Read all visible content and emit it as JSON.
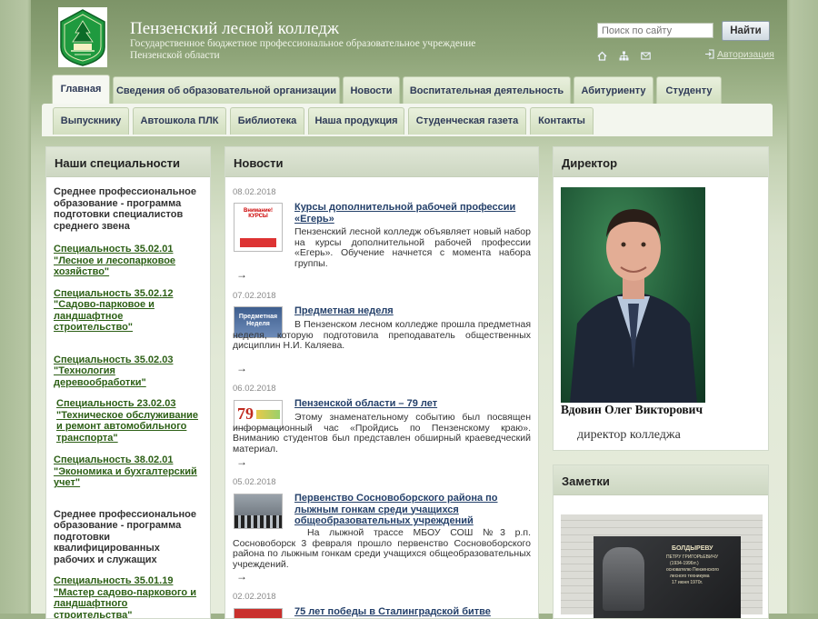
{
  "header": {
    "title": "Пензенский лесной колледж",
    "subtitle": "Государственное бюджетное профессиональное образовательное учреждение Пензенской области",
    "search_placeholder": "Поиск по сайту",
    "search_button": "Найти",
    "login": "Авторизация"
  },
  "nav": {
    "row1": [
      "Главная",
      "Сведения об образовательной организации",
      "Новости",
      "Воспитательная деятельность",
      "Абитуриенту",
      "Студенту"
    ],
    "row2": [
      "Выпускнику",
      "Автошкола ПЛК",
      "Библиотека",
      "Наша продукция",
      "Студенческая газета",
      "Контакты"
    ]
  },
  "specialties": {
    "heading": "Наши специальности",
    "group1_title": "Среднее профессиональное образование - программа подготовки специалистов среднего звена",
    "group1": [
      "Специальность 35.02.01 \"Лесное и лесопарковое хозяйство\"",
      "Специальность 35.02.12 \"Садово-парковое и ландшафтное строительство\"",
      "Специальность 35.02.03 \"Технология деревообработки\"",
      "Специальность 23.02.03 \"Техническое обслуживание и ремонт автомобильного транспорта\"",
      "Специальность 38.02.01 \"Экономика и бухгалтерский учет\""
    ],
    "group2_title": "Среднее профессиональное образование - программа подготовки квалифицированных рабочих и служащих",
    "group2": [
      "Специальность 35.01.19 \"Мастер садово-паркового и ландшафтного строительства\""
    ]
  },
  "news": {
    "heading": "Новости",
    "arrow": "→",
    "items": [
      {
        "date": "08.02.2018",
        "title": "Курсы дополнительной рабочей профессии «Егерь»",
        "text": "Пензенский лесной колледж объявляет новый набор на курсы дополнительной рабочей профессии «Егерь». Обучение начнется с момента набора группы.",
        "thumb": "Внимание! КУРСЫ"
      },
      {
        "date": "07.02.2018",
        "title": "Предметная неделя",
        "text": "В Пензенском лесном колледже прошла предметная неделя, которую подготовила преподаватель общественных дисциплин Н.И. Каляева.",
        "thumb": "Предметная Неделя"
      },
      {
        "date": "06.02.2018",
        "title": "Пензенской области – 79 лет",
        "text": "Этому знаменательному событию был посвящен информационный час «Пройдись по Пензенскому краю». Вниманию студентов был представлен обширный краеведческий материал.",
        "thumb": "79"
      },
      {
        "date": "05.02.2018",
        "title": "Первенство Сосновоборского района по лыжным гонкам среди учащихся общеобразовательных учреждений",
        "text": "На лыжной трассе МБОУ СОШ №3 р.п. Сосновоборск 3 февраля прошло первенство Сосновоборского района по лыжным гонкам среди учащихся общеобразовательных учреждений.",
        "thumb": ""
      },
      {
        "date": "02.02.2018",
        "title": "75 лет победы в Сталинградской битве",
        "text": "",
        "thumb": ""
      }
    ]
  },
  "director": {
    "heading": "Директор",
    "name": "Вдовин Олег Викторович",
    "position": "директор колледжа"
  },
  "notes": {
    "heading": "Заметки",
    "plaque_name": "БОЛДЫРЕВУ",
    "plaque_line2": "ПЕТРУ ГРИГОРЬЕВИЧУ",
    "plaque_line3": "(1934-1996гг.)",
    "plaque_line4": "основателю Пензенского",
    "plaque_line5": "лесного техникума",
    "plaque_line6": "17 июня 1970г."
  },
  "colors": {
    "accent_green": "#2c5f15",
    "link_blue": "#24406a",
    "nav_text": "#2e3a57"
  }
}
